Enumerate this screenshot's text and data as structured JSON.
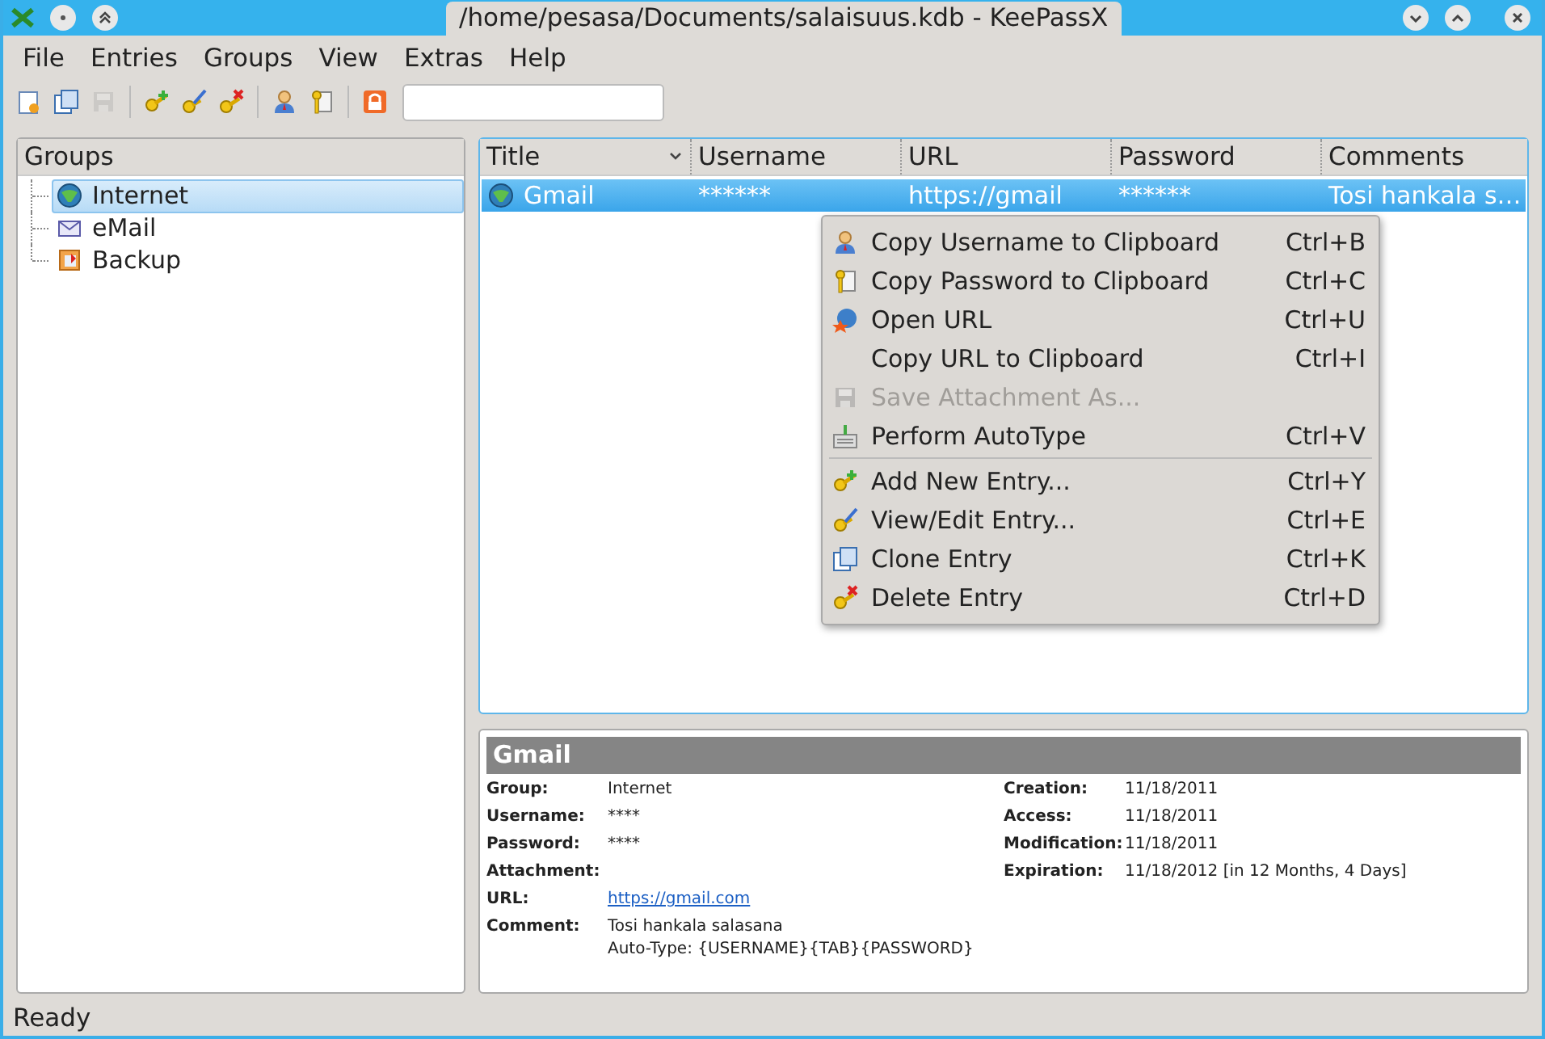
{
  "window": {
    "title": "/home/pesasa/Documents/salaisuus.kdb - KeePassX"
  },
  "menubar": [
    "File",
    "Entries",
    "Groups",
    "View",
    "Extras",
    "Help"
  ],
  "toolbar": {
    "buttons": [
      {
        "kind": "new-db",
        "disabled": false
      },
      {
        "kind": "open",
        "disabled": false
      },
      {
        "kind": "save",
        "disabled": true
      },
      {
        "kind": "sep"
      },
      {
        "kind": "add",
        "disabled": false
      },
      {
        "kind": "edit",
        "disabled": false
      },
      {
        "kind": "delete",
        "disabled": false
      },
      {
        "kind": "sep"
      },
      {
        "kind": "user",
        "disabled": false
      },
      {
        "kind": "key",
        "disabled": false
      },
      {
        "kind": "sep"
      },
      {
        "kind": "lock",
        "disabled": false
      }
    ]
  },
  "groups": {
    "header": "Groups",
    "items": [
      {
        "label": "Internet",
        "kind": "globe",
        "selected": true
      },
      {
        "label": "eMail",
        "kind": "mail",
        "selected": false
      },
      {
        "label": "Backup",
        "kind": "backup",
        "selected": false
      }
    ]
  },
  "entries": {
    "columns": [
      {
        "label": "Title",
        "sorted": true
      },
      {
        "label": "Username",
        "sorted": false
      },
      {
        "label": "URL",
        "sorted": false
      },
      {
        "label": "Password",
        "sorted": false
      },
      {
        "label": "Comments",
        "sorted": false
      }
    ],
    "rows": [
      {
        "selected": true,
        "cells": [
          "Gmail",
          "******",
          "https://gmail",
          "******",
          "Tosi hankala s…"
        ]
      }
    ]
  },
  "context_menu": [
    {
      "kind": "user",
      "label": "Copy Username to Clipboard",
      "shortcut": "Ctrl+B",
      "disabled": false
    },
    {
      "kind": "key",
      "label": "Copy Password to Clipboard",
      "shortcut": "Ctrl+C",
      "disabled": false
    },
    {
      "kind": "open",
      "label": "Open URL",
      "shortcut": "Ctrl+U",
      "disabled": false
    },
    {
      "kind": "plain",
      "label": "Copy URL to Clipboard",
      "shortcut": "Ctrl+I",
      "disabled": false
    },
    {
      "kind": "save",
      "label": "Save Attachment As...",
      "disabled": true
    },
    {
      "kind": "autotype",
      "label": "Perform AutoType",
      "shortcut": "Ctrl+V",
      "disabled": false
    },
    {
      "kind": "separator"
    },
    {
      "kind": "add",
      "label": "Add New Entry...",
      "shortcut": "Ctrl+Y",
      "disabled": false
    },
    {
      "kind": "edit",
      "label": "View/Edit Entry...",
      "shortcut": "Ctrl+E",
      "disabled": false
    },
    {
      "kind": "clone",
      "label": "Clone Entry",
      "shortcut": "Ctrl+K",
      "disabled": false
    },
    {
      "kind": "delete",
      "label": "Delete Entry",
      "shortcut": "Ctrl+D",
      "disabled": false
    }
  ],
  "details": {
    "title": "Gmail",
    "left": [
      {
        "label": "Group:",
        "values": [
          "Internet"
        ]
      },
      {
        "label": "Username:",
        "values": [
          "****"
        ]
      },
      {
        "label": "Password:",
        "values": [
          "****"
        ]
      },
      {
        "label": "Attachment:"
      },
      {
        "label": "URL:",
        "values": [
          "https://gmail.com"
        ],
        "kind": "link"
      },
      {
        "label": "Comment:",
        "values": [
          "Tosi hankala salasana",
          "Auto-Type: {USERNAME}{TAB}{PASSWORD}"
        ]
      }
    ],
    "right": [
      {
        "label": "Creation:",
        "values": [
          "11/18/2011"
        ]
      },
      {
        "label": "Access:",
        "values": [
          "11/18/2011"
        ]
      },
      {
        "label": "Modification:",
        "values": [
          "11/18/2011"
        ]
      },
      {
        "label": "Expiration:",
        "values": [
          "11/18/2012 [in 12 Months, 4 Days]"
        ]
      }
    ]
  },
  "status_bar": "Ready"
}
